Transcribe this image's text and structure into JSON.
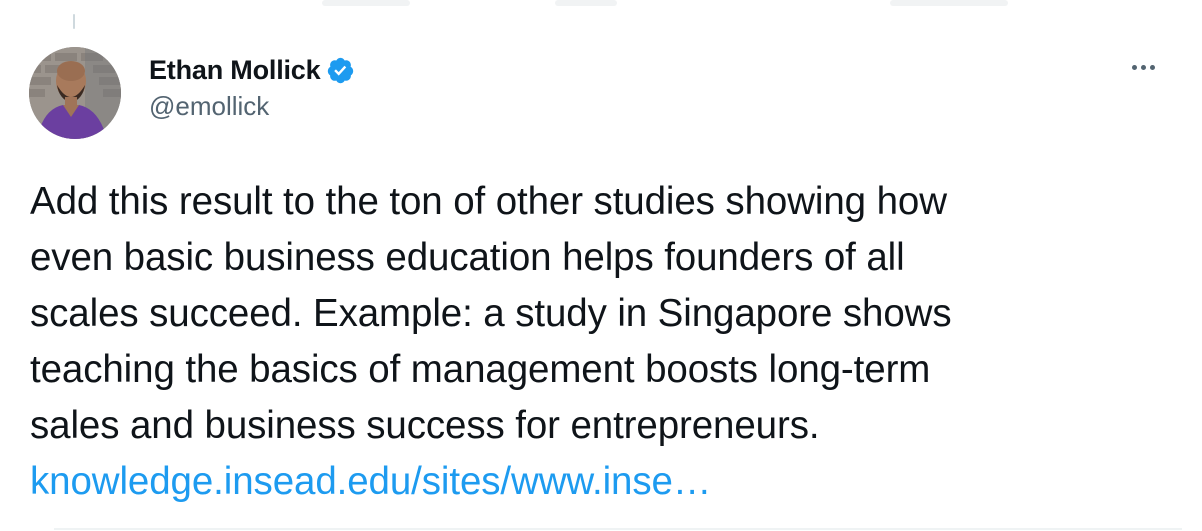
{
  "author": {
    "display_name": "Ethan Mollick",
    "handle": "@emollick",
    "verified": true,
    "avatar_icon": "profile-photo"
  },
  "tweet": {
    "text_lines": [
      "Add this result to the ton of other studies showing how",
      "even basic business education helps founders of all",
      "scales succeed. Example: a study in Singapore shows",
      "teaching the basics of management boosts long-term",
      "sales and business success for entrepreneurs."
    ],
    "link": "knowledge.insead.edu/sites/www.inse…"
  },
  "icons": {
    "verified": "verified-badge-icon",
    "more": "more-options-icon"
  },
  "colors": {
    "link": "#1d9bf0",
    "verified": "#1d9bf0",
    "secondary_text": "#536471",
    "primary_text": "#0f1419"
  }
}
